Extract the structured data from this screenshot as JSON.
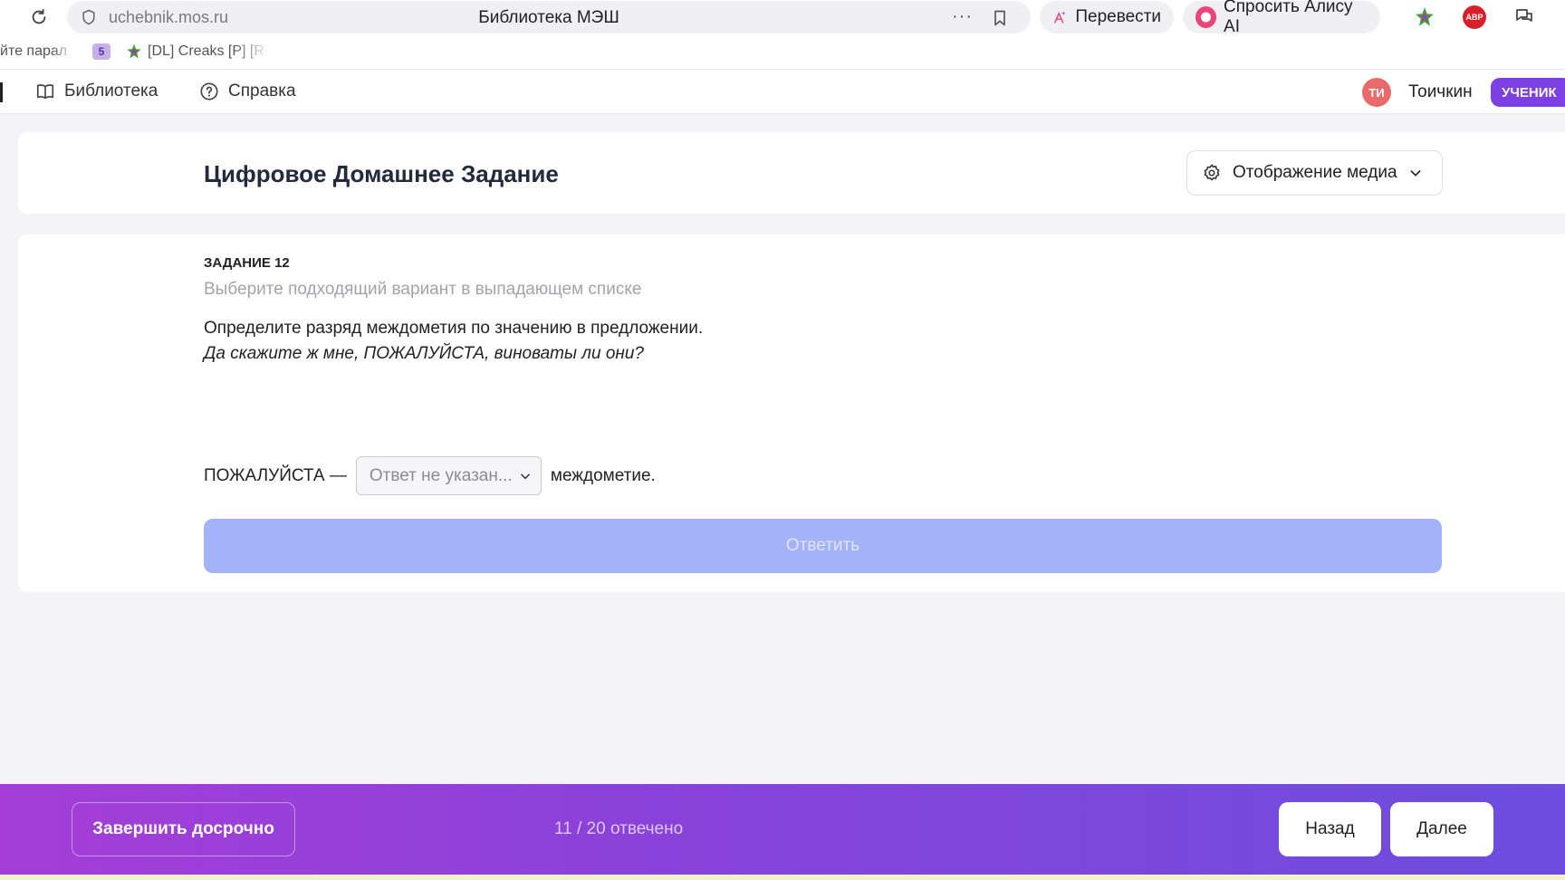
{
  "browser": {
    "url": "uchebnik.mos.ru",
    "tab_title": "Библиотека МЭШ",
    "more_glyph": "···",
    "translate_label": "Перевести",
    "alice_label": "Спросить Алису AI",
    "abp_label": "ABP"
  },
  "bookmarks": {
    "item1": "йте парал",
    "item2_badge": "5",
    "item3": "[DL] Creaks [P] [R"
  },
  "nav": {
    "library_label": "Библиотека",
    "help_label": "Справка",
    "avatar_initials": "ТИ",
    "user_name": "Тоичкин",
    "role_badge": "УЧЕНИК"
  },
  "header": {
    "title": "Цифровое Домашнее Задание",
    "media_button_label": "Отображение медиа"
  },
  "task": {
    "number_label": "ЗАДАНИЕ 12",
    "hint": "Выберите подходящий вариант в выпадающем списке",
    "question": "Определите разряд междометия по значению в предложении.",
    "sentence": "Да скажите ж мне, ПОЖАЛУЙСТА, виноваты ли они?",
    "answer_prefix": "ПОЖАЛУЙСТА —",
    "select_placeholder": "Ответ не указан...",
    "answer_suffix": "междометие.",
    "submit_label": "Ответить"
  },
  "footer": {
    "finish_label": "Завершить досрочно",
    "progress": "11 / 20 отвечено",
    "back_label": "Назад",
    "next_label": "Далее"
  },
  "colors": {
    "accent_purple": "#7b3fe4",
    "footer_gradient_start": "#a53ed8",
    "footer_gradient_end": "#6c4ddd",
    "submit_disabled": "#a4b3f7",
    "avatar_red": "#e86a6a"
  }
}
